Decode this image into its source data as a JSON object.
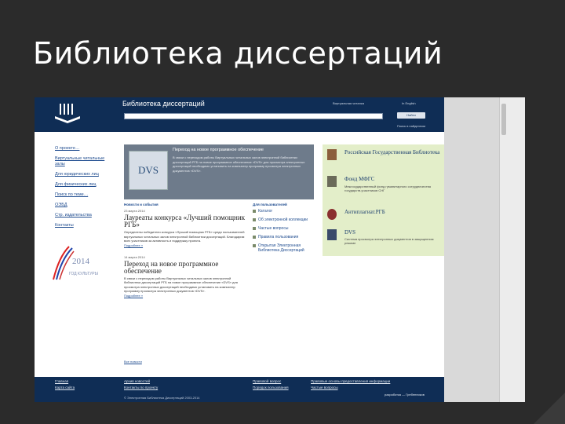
{
  "slide": {
    "title": "Библиотека диссертаций"
  },
  "header": {
    "site_title": "Библиотека диссертаций",
    "virtual_reading_room": "Виртуальная читалка",
    "english": "In English",
    "search_button": "Найти",
    "search_sub": "Поиск в найденном"
  },
  "left_nav": {
    "items": [
      "О проекте…",
      "Виртуальные читальные залы",
      "Для юридических лиц",
      "Для физических лиц",
      "Поиск по теме…",
      "ОЭБД",
      "Стр. издательства",
      "Контакты"
    ],
    "year_logo": "2014",
    "year_caption": "ГОД КУЛЬТУРЫ"
  },
  "banner": {
    "logo": "DVS",
    "title": "Переход на новое программное обеспечение",
    "text": "В связи с переходом работы Виртуальных читальных залов электронной библиотеки диссертаций РГБ на новое программное обеспечение «DVS» для просмотра электронных диссертаций необходимо установить на компьютер программу просмотра электронных документов «DVS»."
  },
  "news": {
    "header": "Новости и события",
    "items": [
      {
        "date": "23 марта 2014",
        "title": "Лауреаты конкурса «Лучший помощник РГБ»",
        "text": "Определены победители конкурса «Лучший помощник РГБ» среди пользователей виртуальных читальных залов электронной библиотеки диссертаций. Благодарим всех участников за активность и поддержку проекта.",
        "more": "Подробнее »"
      },
      {
        "date": "14 марта 2014",
        "title": "Переход на новое программное обеспечение",
        "text": "В связи с переходом работы Виртуальных читальных залов электронной библиотеки диссертаций РГБ на новое программное обеспечение «DVS» для просмотра электронных диссертаций необходимо установить на компьютер программу просмотра электронных документов «DVS».",
        "more": "Подробнее »"
      }
    ],
    "all_news": "Все новости"
  },
  "users": {
    "header": "Для пользователей",
    "items": [
      "Каталог",
      "Об электронной коллекции",
      "Частые вопросы",
      "Правила пользования",
      "Открытая Электронная Библиотека Диссертаций"
    ]
  },
  "partners": [
    {
      "name": "Российская Государственная Библиотека",
      "desc": ""
    },
    {
      "name": "Фонд МФГС",
      "desc": "Межгосударственный фонд гуманитарного сотрудничества государств-участников СНГ"
    },
    {
      "name": "Антиплагиат.РГБ",
      "desc": ""
    },
    {
      "name": "DVS",
      "desc": "Система просмотра электронных документов в защищенном режиме"
    }
  ],
  "footer": {
    "col1": [
      "Главная",
      "Карта сайта"
    ],
    "col2": [
      "Архив новостей",
      "Контакты по проекту"
    ],
    "col3": [
      "Правовой вопрос",
      "Порядок пользования"
    ],
    "col4": [
      "Правовые основы предоставления информации",
      "Частые вопросы"
    ],
    "copyright": "© Электронная Библиотека Диссертаций 2003-2014",
    "credit": "разработка — Гребенников"
  },
  "colors": {
    "header_bg": "#0f2d55",
    "panel_bg": "#e3eec9",
    "banner_bg": "#6e7b8b",
    "link": "#1f4c8f"
  }
}
